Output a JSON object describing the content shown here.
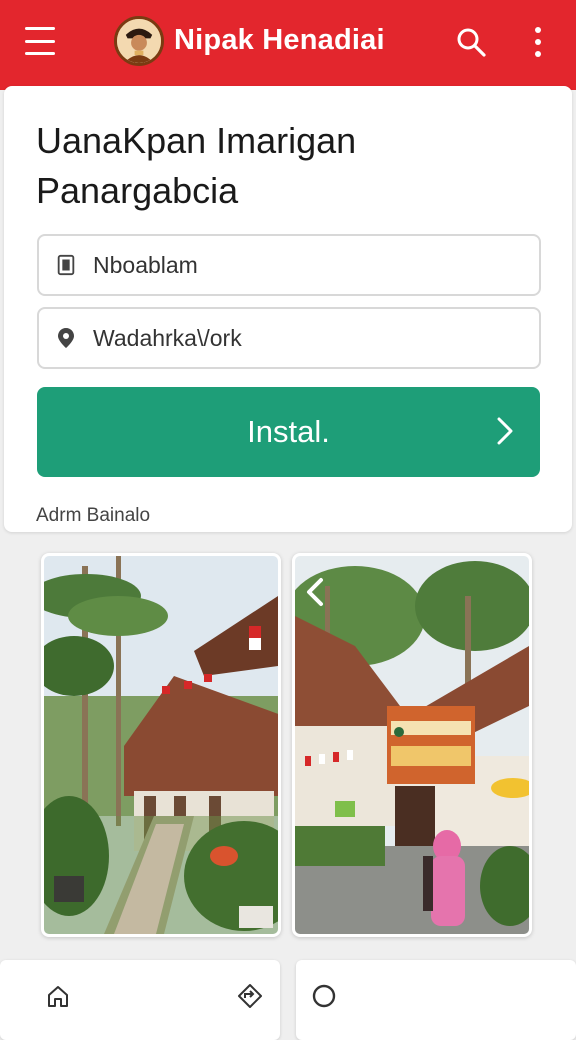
{
  "app": {
    "title": "Nipak Henadiai",
    "accent": "#e3262d"
  },
  "header": {
    "menu_icon": "hamburger-menu-icon",
    "logo_icon": "portrait-logo-icon",
    "search_icon": "search-icon",
    "more_icon": "more-vert-icon"
  },
  "main": {
    "heading_line1": "UanaKpan Imarigan",
    "heading_line2": "Panargabcia",
    "field1": {
      "value": "Nboablam",
      "icon": "document-icon"
    },
    "field2": {
      "value": "Wadahrka\\/ork",
      "icon": "location-pin-icon"
    },
    "install_label": "Instal.",
    "install_color": "#1e9e78",
    "caption": "Adrm Bainalo"
  },
  "bottom": {
    "left_icons": [
      "home-icon",
      "directions-icon"
    ],
    "right_icons": [
      "circle-icon"
    ]
  }
}
